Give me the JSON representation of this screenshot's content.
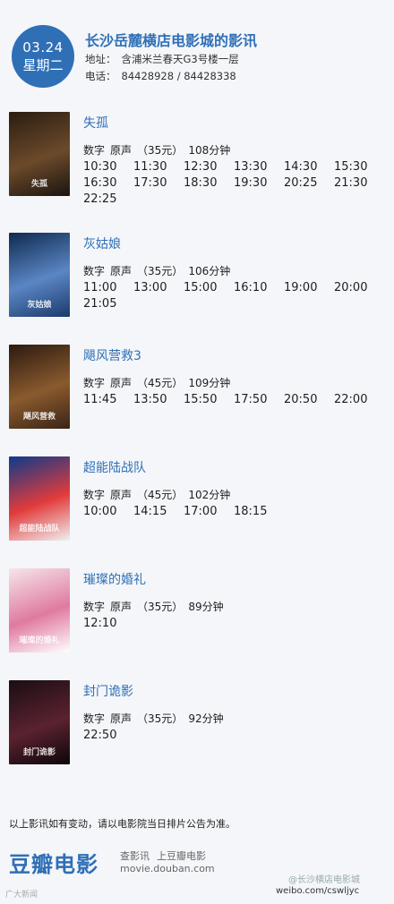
{
  "header": {
    "date": "03.24",
    "weekday": "星期二",
    "cinema": "长沙岳麓横店电影城的影讯",
    "address_label": "地址：",
    "address": "含浦米兰春天G3号楼一层",
    "phone_label": "电话：",
    "phone": "84428928 / 84428338"
  },
  "movies": [
    {
      "title": "失孤",
      "format": "数字",
      "audio": "原声",
      "price": "（35元）",
      "duration": "108分钟",
      "times": [
        "10:30",
        "11:30",
        "12:30",
        "13:30",
        "14:30",
        "15:30",
        "16:30",
        "17:30",
        "18:30",
        "19:30",
        "20:25",
        "21:30",
        "22:25"
      ],
      "poster_text": "失孤",
      "poster_colors": [
        "#2a1d12",
        "#6b4a2a",
        "#1a1410"
      ]
    },
    {
      "title": "灰姑娘",
      "format": "数字",
      "audio": "原声",
      "price": "（35元）",
      "duration": "106分钟",
      "times": [
        "11:00",
        "13:00",
        "15:00",
        "16:10",
        "19:00",
        "20:00",
        "21:05"
      ],
      "poster_text": "灰姑娘",
      "poster_colors": [
        "#0f2a4f",
        "#5a86c4",
        "#1b3a6b"
      ]
    },
    {
      "title": "飓风营救3",
      "format": "数字",
      "audio": "原声",
      "price": "（45元）",
      "duration": "109分钟",
      "times": [
        "11:45",
        "13:50",
        "15:50",
        "17:50",
        "20:50",
        "22:00"
      ],
      "poster_text": "飓风营救",
      "poster_colors": [
        "#2b1a10",
        "#8a5a2e",
        "#3a2416"
      ]
    },
    {
      "title": "超能陆战队",
      "format": "数字",
      "audio": "原声",
      "price": "（45元）",
      "duration": "102分钟",
      "times": [
        "10:00",
        "14:15",
        "17:00",
        "18:15"
      ],
      "poster_text": "超能陆战队",
      "poster_colors": [
        "#0d3a8a",
        "#e23b3b",
        "#f0f0f0"
      ]
    },
    {
      "title": "璀璨的婚礼",
      "format": "数字",
      "audio": "原声",
      "price": "（35元）",
      "duration": "89分钟",
      "times": [
        "12:10"
      ],
      "poster_text": "璀璨的婚礼",
      "poster_colors": [
        "#f5e6ea",
        "#e07aa0",
        "#ffffff"
      ]
    },
    {
      "title": "封门诡影",
      "format": "数字",
      "audio": "原声",
      "price": "（35元）",
      "duration": "92分钟",
      "times": [
        "22:50"
      ],
      "poster_text": "封门诡影",
      "poster_colors": [
        "#1a0e12",
        "#5a2230",
        "#0c0608"
      ]
    }
  ],
  "footer": {
    "notice": "以上影讯如有变动，请以电影院当日排片公告为准。",
    "logo": "豆瓣电影",
    "slogan1": "查影讯",
    "slogan2": "上豆瓣电影",
    "site": "movie.douban.com",
    "watermark_left": "广大新闻",
    "watermark_right1": "@长沙横店电影城",
    "watermark_right2": "weibo.com/cswljyc"
  }
}
